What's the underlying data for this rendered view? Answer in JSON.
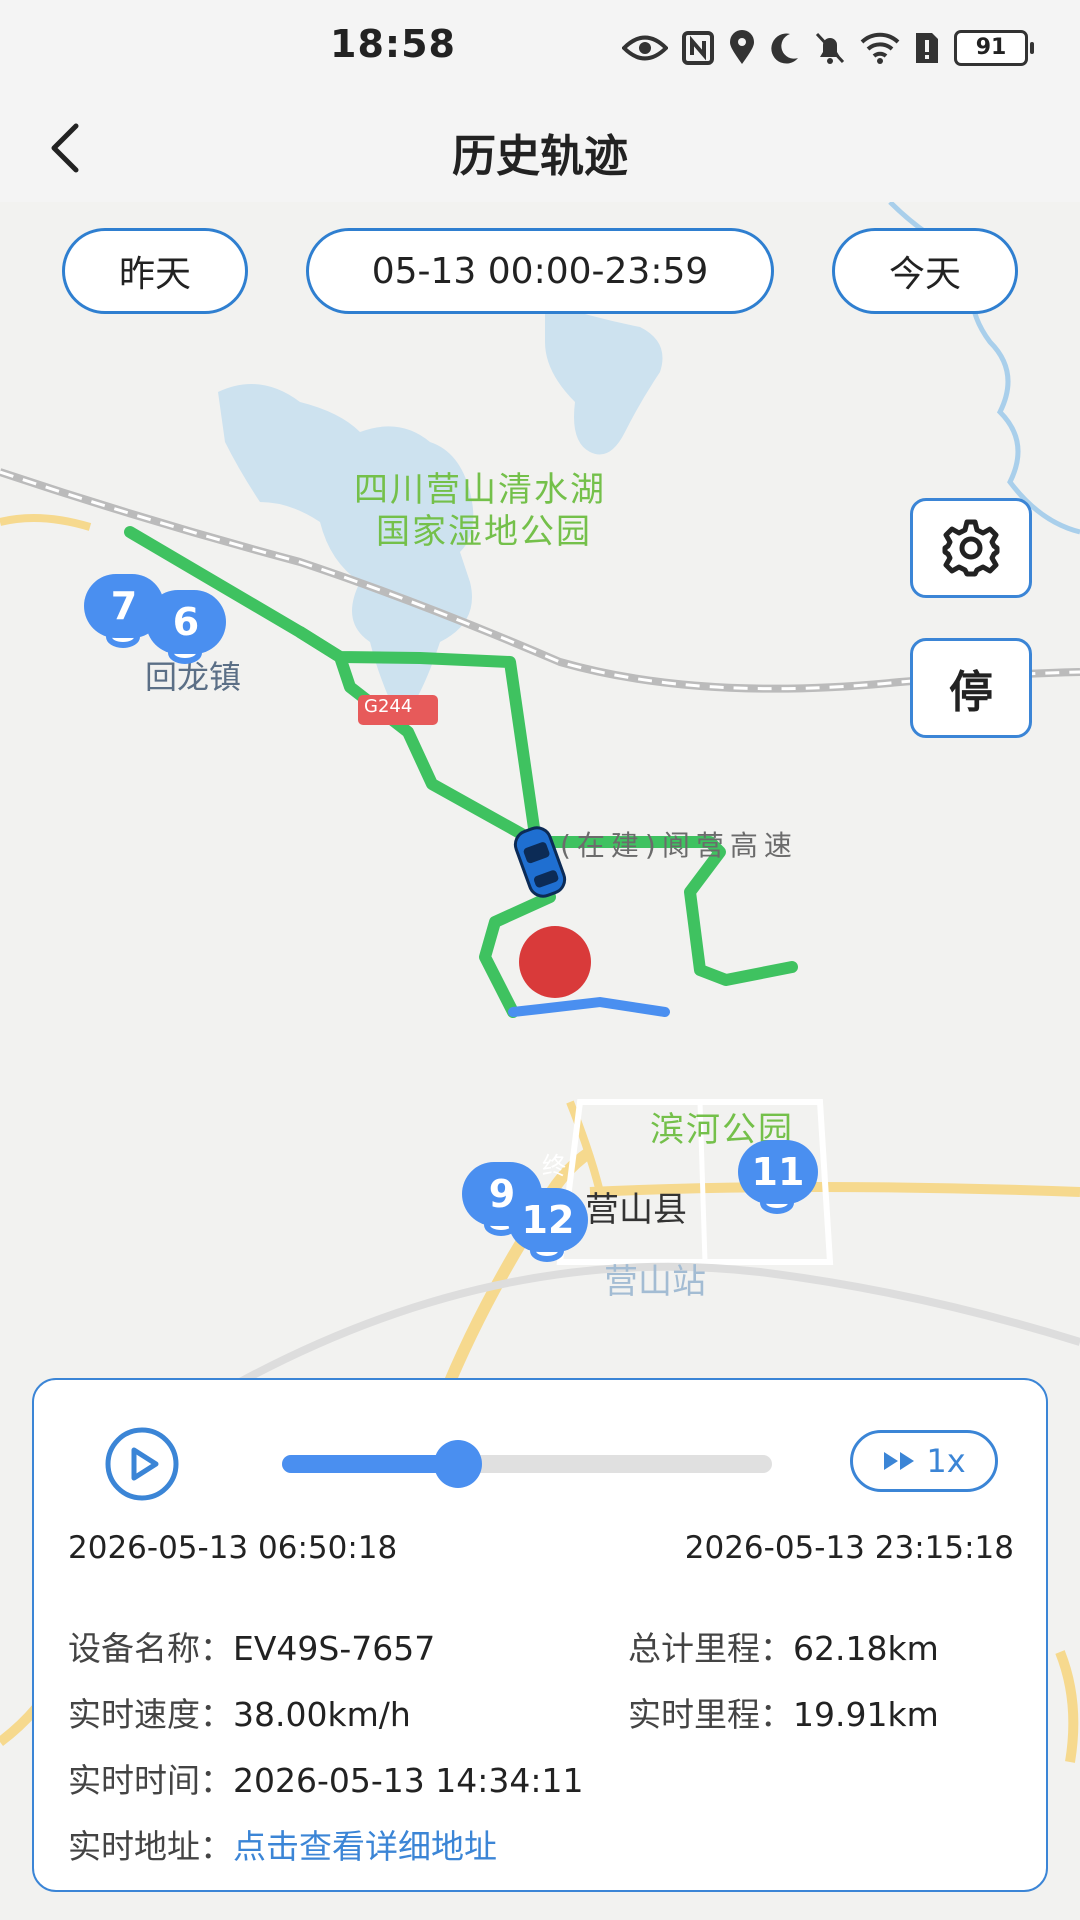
{
  "status_bar": {
    "time": "18:58",
    "battery": "91"
  },
  "header": {
    "title": "历史轨迹"
  },
  "date_controls": {
    "prev_label": "昨天",
    "range_label": "05-13 00:00-23:59",
    "next_label": "今天"
  },
  "side_buttons": {
    "stop_label": "停"
  },
  "map": {
    "labels": {
      "wetland_line1": "四川营山清水湖",
      "wetland_line2": "国家湿地公园",
      "town": "回龙镇",
      "highway": "(在建)阆营高速",
      "road_badge": "G244",
      "park": "滨河公园",
      "county": "营山县",
      "station": "营山站",
      "end_marker": "终"
    },
    "markers": [
      "7",
      "6",
      "9",
      "12",
      "11"
    ]
  },
  "playback": {
    "progress": 0.36,
    "speed_label": "1x",
    "start_time": "2026-05-13 06:50:18",
    "end_time": "2026-05-13 23:15:18"
  },
  "info": {
    "device_name_key": "设备名称：",
    "device_name_val": "EV49S-7657",
    "total_mileage_key": "总计里程：",
    "total_mileage_val": "62.18km",
    "realtime_speed_key": "实时速度：",
    "realtime_speed_val": "38.00km/h",
    "realtime_mileage_key": "实时里程：",
    "realtime_mileage_val": "19.91km",
    "realtime_time_key": "实时时间：",
    "realtime_time_val": "2026-05-13 14:34:11",
    "realtime_address_key": "实时地址：",
    "realtime_address_link": "点击查看详细地址"
  }
}
